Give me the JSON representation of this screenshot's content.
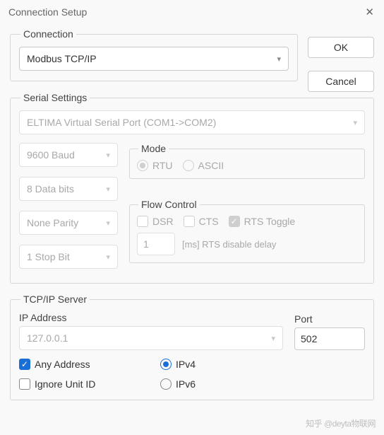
{
  "titlebar": {
    "title": "Connection Setup"
  },
  "buttons": {
    "ok": "OK",
    "cancel": "Cancel"
  },
  "connection": {
    "legend": "Connection",
    "value": "Modbus TCP/IP"
  },
  "serial": {
    "legend": "Serial Settings",
    "port": "ELTIMA Virtual Serial Port (COM1->COM2)",
    "baud": "9600 Baud",
    "databits": "8 Data bits",
    "parity": "None Parity",
    "stopbit": "1 Stop Bit",
    "mode": {
      "legend": "Mode",
      "rtu": "RTU",
      "ascii": "ASCII"
    },
    "flow": {
      "legend": "Flow Control",
      "dsr": "DSR",
      "cts": "CTS",
      "rts": "RTS Toggle",
      "delay_value": "1",
      "delay_label": "[ms] RTS disable delay"
    }
  },
  "tcp": {
    "legend": "TCP/IP Server",
    "ip_label": "IP Address",
    "ip_value": "127.0.0.1",
    "port_label": "Port",
    "port_value": "502",
    "any": "Any Address",
    "ignore": "Ignore Unit ID",
    "ipv4": "IPv4",
    "ipv6": "IPv6"
  },
  "watermark": "知乎 @deyta物联网"
}
